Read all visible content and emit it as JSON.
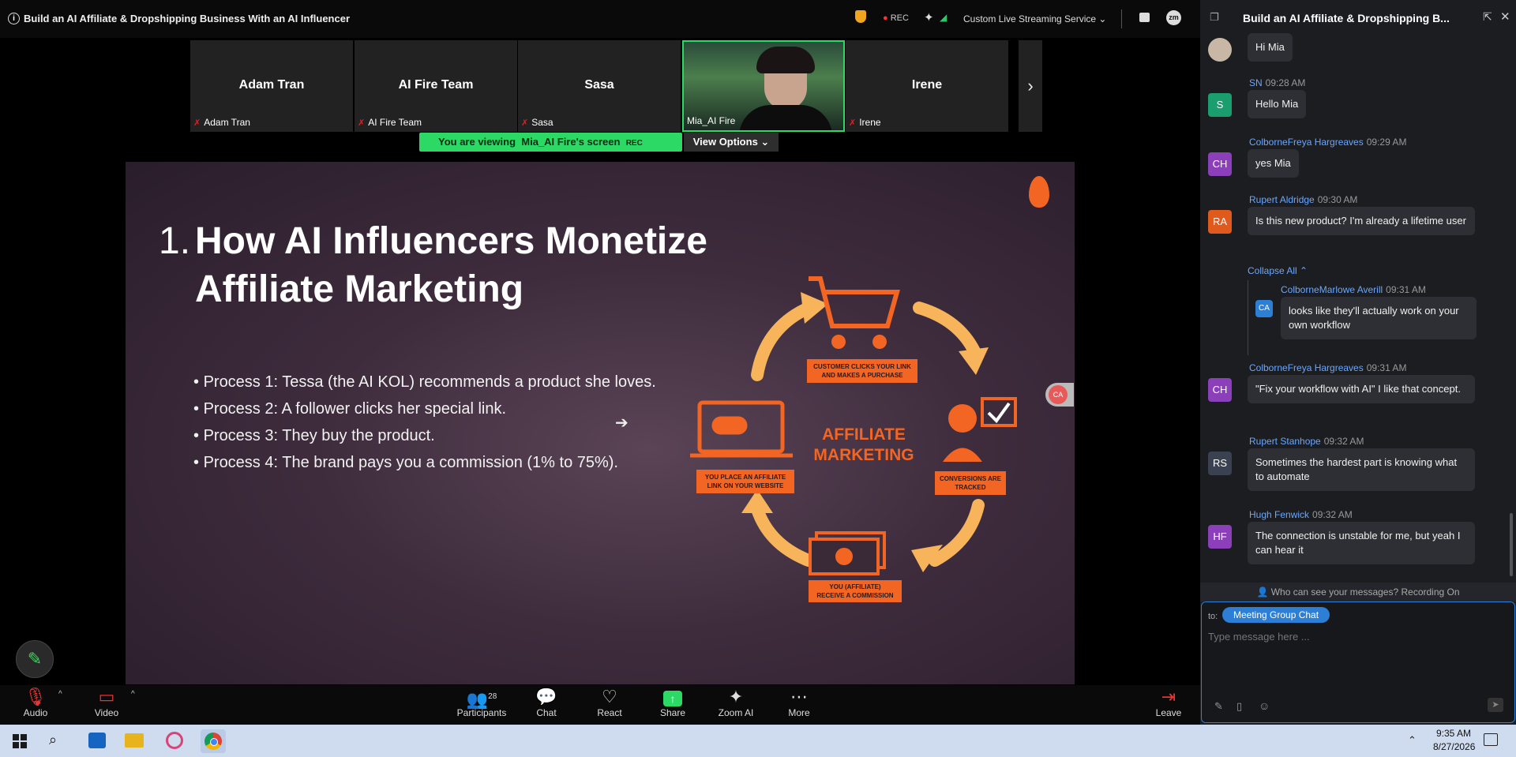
{
  "window": {
    "title": "Build an AI Affiliate & Dropshipping Business With an AI Influencer",
    "rec": "REC",
    "streaming": "Custom Live Streaming Service"
  },
  "gallery": [
    {
      "big": "Adam Tran",
      "small": "Adam Tran"
    },
    {
      "big": "AI Fire Team",
      "small": "AI Fire Team"
    },
    {
      "big": "Sasa",
      "small": "Sasa"
    },
    {
      "big": "",
      "small": "Mia_AI Fire"
    },
    {
      "big": "Irene",
      "small": "Irene"
    }
  ],
  "viewing": {
    "prefix": "You are viewing",
    "name": "Mia_AI Fire's screen",
    "rec": "REC",
    "options": "View Options"
  },
  "slide": {
    "num": "1.",
    "title": "How AI Influencers Monetize Affiliate Marketing",
    "bullets": [
      "Process 1: Tessa (the AI KOL) recommends a product she loves.",
      "Process 2: A follower clicks her special link.",
      "Process 3: They buy the product.",
      "Process 4: The brand pays you a commission (1% to 75%)."
    ],
    "diagram": {
      "center": [
        "AFFILIATE",
        "MARKETING"
      ],
      "top": [
        "CUSTOMER CLICKS YOUR LINK",
        "AND MAKES A PURCHASE"
      ],
      "right": [
        "CONVERSIONS ARE",
        "TRACKED"
      ],
      "bottom": [
        "YOU (AFFILIATE)",
        "RECEIVE A COMMISSION"
      ],
      "left": [
        "YOU PLACE AN AFFILIATE",
        "LINK ON YOUR WEBSITE"
      ],
      "accent": "#f26522",
      "arrow": "#f7b45b"
    },
    "badge": "CA"
  },
  "chat": {
    "title": "Build an AI Affiliate & Dropshipping B...",
    "messages": [
      {
        "initials": "",
        "color": "#555",
        "sender": "",
        "time": "",
        "text": "Hi Mia"
      },
      {
        "initials": "S",
        "color": "#1a9e6e",
        "sender": "SN",
        "time": "09:28 AM",
        "text": "Hello Mia"
      },
      {
        "initials": "CH",
        "color": "#8b3fb8",
        "sender": "ColborneFreya Hargreaves",
        "time": "09:29 AM",
        "text": "yes Mia"
      },
      {
        "initials": "RA",
        "color": "#e05a1e",
        "sender": "Rupert Aldridge",
        "time": "09:30 AM",
        "text": "Is this new product? I'm already a lifetime user"
      },
      {
        "initials": "CA",
        "color": "#2d7fd6",
        "sender": "ColborneMarlowe Averill",
        "time": "09:31 AM",
        "text": "looks like they'll actually work on your own workflow"
      },
      {
        "initials": "CH",
        "color": "#8b3fb8",
        "sender": "ColborneFreya Hargreaves",
        "time": "09:31 AM",
        "text": "\"Fix your workflow with AI\"  I like that concept."
      },
      {
        "initials": "RS",
        "color": "#3a4150",
        "sender": "Rupert Stanhope",
        "time": "09:32 AM",
        "text": "Sometimes the hardest part is knowing what to automate"
      },
      {
        "initials": "HF",
        "color": "#8b3fb8",
        "sender": "Hugh Fenwick",
        "time": "09:32 AM",
        "text": "The connection is unstable for me, but yeah I can hear it"
      }
    ],
    "collapse": "Collapse All",
    "notice": "Who can see your messages? Recording On",
    "to_label": "to:",
    "to_target": "Meeting Group Chat",
    "placeholder": "Type message here ..."
  },
  "toolbar": {
    "audio": "Audio",
    "video": "Video",
    "participants": "Participants",
    "participants_count": "28",
    "chat": "Chat",
    "react": "React",
    "share": "Share",
    "zoom_ai": "Zoom AI",
    "more": "More",
    "leave": "Leave"
  },
  "taskbar": {
    "time": "9:35 AM",
    "date": "8/27/2026"
  }
}
